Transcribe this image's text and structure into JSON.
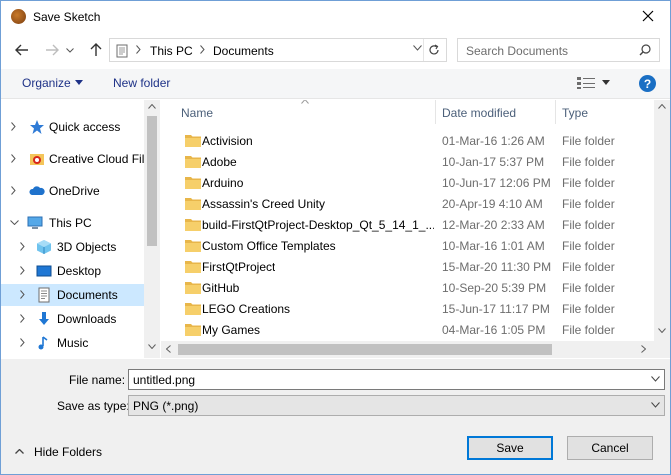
{
  "window": {
    "title": "Save Sketch"
  },
  "address": {
    "crumbs": [
      "This PC",
      "Documents"
    ],
    "search_placeholder": "Search Documents"
  },
  "toolbar": {
    "organize_label": "Organize",
    "new_folder_label": "New folder",
    "help_label": "?"
  },
  "nav": {
    "items": [
      {
        "label": "Quick access",
        "icon": "star-icon"
      },
      {
        "label": "Creative Cloud Files",
        "icon": "creative-cloud-icon"
      },
      {
        "label": "OneDrive",
        "icon": "cloud-icon"
      },
      {
        "label": "This PC",
        "icon": "computer-icon"
      },
      {
        "label": "3D Objects",
        "icon": "cube-icon"
      },
      {
        "label": "Desktop",
        "icon": "desktop-icon"
      },
      {
        "label": "Documents",
        "icon": "document-icon",
        "selected": true
      },
      {
        "label": "Downloads",
        "icon": "download-icon"
      },
      {
        "label": "Music",
        "icon": "music-icon"
      }
    ]
  },
  "list": {
    "columns": {
      "name": "Name",
      "date": "Date modified",
      "type": "Type"
    },
    "rows": [
      {
        "name": "Activision",
        "date": "01-Mar-16 1:26 AM",
        "type": "File folder"
      },
      {
        "name": "Adobe",
        "date": "10-Jan-17 5:37 PM",
        "type": "File folder"
      },
      {
        "name": "Arduino",
        "date": "10-Jun-17 12:06 PM",
        "type": "File folder"
      },
      {
        "name": "Assassin's Creed Unity",
        "date": "20-Apr-19 4:10 AM",
        "type": "File folder"
      },
      {
        "name": "build-FirstQtProject-Desktop_Qt_5_14_1_...",
        "date": "12-Mar-20 2:33 AM",
        "type": "File folder"
      },
      {
        "name": "Custom Office Templates",
        "date": "10-Mar-16 1:01 AM",
        "type": "File folder"
      },
      {
        "name": "FirstQtProject",
        "date": "15-Mar-20 11:30 PM",
        "type": "File folder"
      },
      {
        "name": "GitHub",
        "date": "10-Sep-20 5:39 PM",
        "type": "File folder"
      },
      {
        "name": "LEGO Creations",
        "date": "15-Jun-17 11:17 PM",
        "type": "File folder"
      },
      {
        "name": "My Games",
        "date": "04-Mar-16 1:05 PM",
        "type": "File folder"
      }
    ]
  },
  "form": {
    "file_name_label": "File name:",
    "file_name_value": "untitled.png",
    "save_type_label": "Save as type:",
    "save_type_value": "PNG (*.png)"
  },
  "footer": {
    "hide_folders_label": "Hide Folders",
    "save_label": "Save",
    "cancel_label": "Cancel"
  }
}
